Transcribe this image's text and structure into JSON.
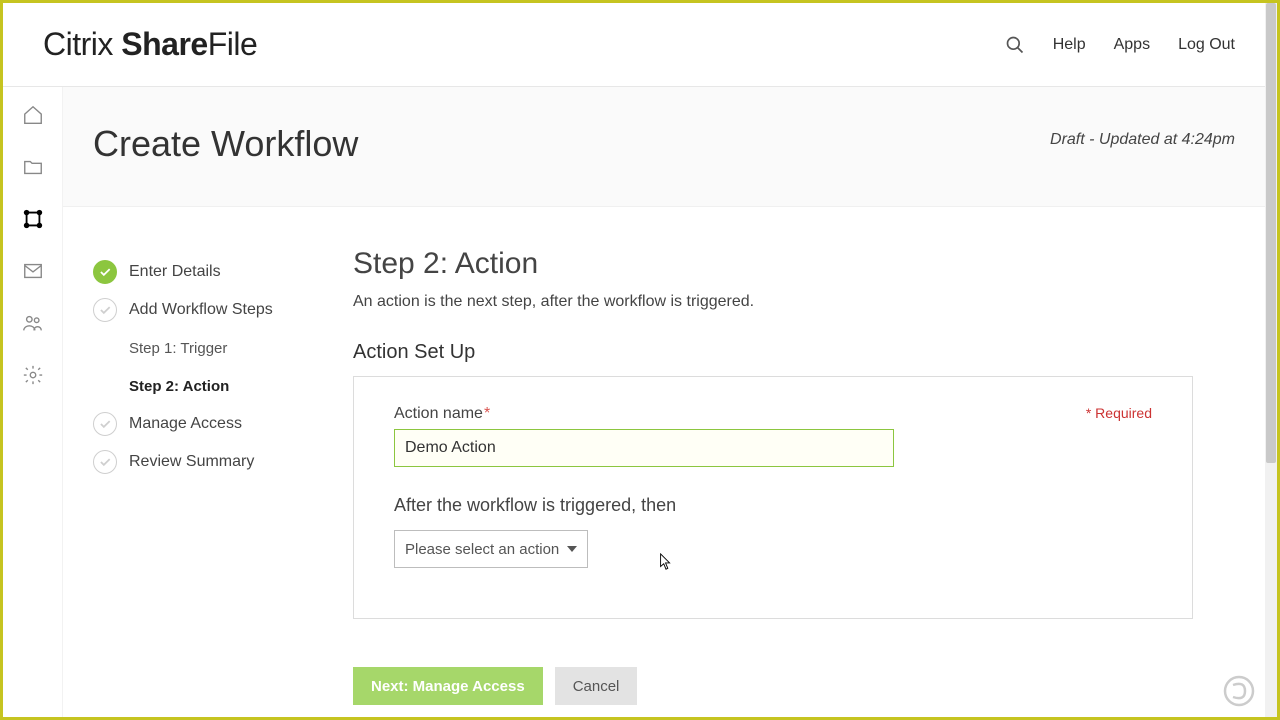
{
  "brand": {
    "prefix": "Citrix ",
    "main": "Share",
    "suffix": "File"
  },
  "topnav": {
    "help": "Help",
    "apps": "Apps",
    "logout": "Log Out"
  },
  "page": {
    "title": "Create Workflow",
    "status": "Draft - Updated at 4:24pm"
  },
  "wizard": {
    "steps": [
      {
        "label": "Enter Details"
      },
      {
        "label": "Add Workflow Steps"
      },
      {
        "label": "Step 1: Trigger"
      },
      {
        "label": "Step 2: Action"
      },
      {
        "label": "Manage Access"
      },
      {
        "label": "Review Summary"
      }
    ]
  },
  "form": {
    "title": "Step 2: Action",
    "description": "An action is the next step, after the workflow is triggered.",
    "section": "Action Set Up",
    "required_note": "* Required",
    "action_name_label": "Action name",
    "action_name_value": "Demo Action",
    "after_label": "After the workflow is triggered, then",
    "select_placeholder": "Please select an action"
  },
  "buttons": {
    "next": "Next: Manage Access",
    "cancel": "Cancel"
  }
}
